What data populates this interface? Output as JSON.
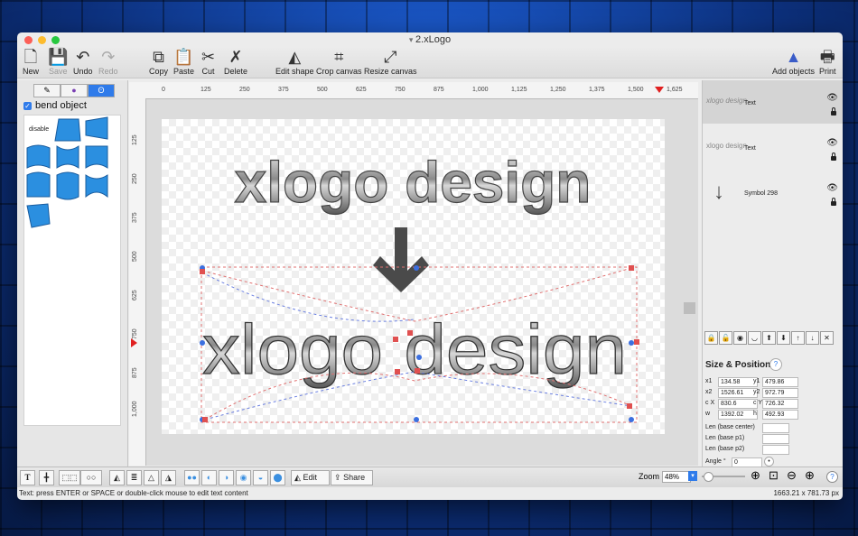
{
  "window": {
    "title": "2.xLogo"
  },
  "toolbar": {
    "new": "New",
    "save": "Save",
    "undo": "Undo",
    "redo": "Redo",
    "copy": "Copy",
    "paste": "Paste",
    "cut": "Cut",
    "delete": "Delete",
    "edit_shape": "Edit shape",
    "crop_canvas": "Crop canvas",
    "resize_canvas": "Resize canvas",
    "add_objects": "Add objects",
    "print": "Print"
  },
  "left_panel": {
    "bend_object_label": "bend object",
    "bend_object_checked": true,
    "disable_label": "disable"
  },
  "ruler_h": [
    "0",
    "125",
    "250",
    "375",
    "500",
    "625",
    "750",
    "875",
    "1,000",
    "1,125",
    "1,250",
    "1,375",
    "1,500",
    "1,625"
  ],
  "ruler_v": [
    "125",
    "250",
    "375",
    "500",
    "625",
    "750",
    "875",
    "1,000"
  ],
  "canvas": {
    "top_text": "xlogo design",
    "bent_text": "xlogo design"
  },
  "layers": [
    {
      "thumb": "xlogo design",
      "name": "Text",
      "selected": true
    },
    {
      "thumb": "xlogo design",
      "name": "Text",
      "selected": false
    },
    {
      "thumb": "↓",
      "name": "Symbol 298",
      "selected": false
    }
  ],
  "size_position": {
    "title": "Size & Position",
    "help": "?",
    "x1_label": "x1",
    "x1": "134.58",
    "y1_label": "y1",
    "y1": "479.86",
    "x2_label": "x2",
    "x2": "1526.61",
    "y2_label": "y2",
    "y2": "972.79",
    "cx_label": "c X",
    "cx": "830.6",
    "cy_label": "c Y",
    "cy": "726.32",
    "w_label": "w",
    "w": "1392.02",
    "h_label": "h",
    "h": "492.93",
    "len_center_label": "Len (base center)",
    "len_p1_label": "Len (base p1)",
    "len_p2_label": "Len (base p2)",
    "angle_label": "Angle °",
    "angle": "0"
  },
  "bottom": {
    "edit_label": "Edit",
    "share_label": "Share",
    "zoom_label": "Zoom",
    "zoom_value": "48%",
    "zoom_fraction": 0.05,
    "help": "?"
  },
  "status": {
    "hint": "Text: press ENTER or SPACE or double-click mouse to edit text content",
    "dimensions": "1663.21 x 781.73 px"
  },
  "colors": {
    "accent": "#2f7bea",
    "shape_fill": "#2b8fe0",
    "handle_red": "#e05050",
    "handle_blue": "#3b6fe0"
  }
}
